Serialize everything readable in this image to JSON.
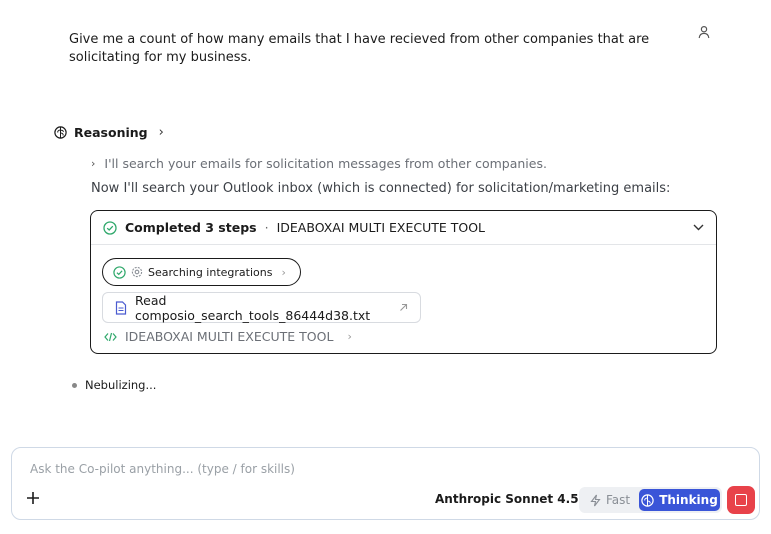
{
  "message": {
    "user_text": "Give me a count of how many emails that I have recieved from other companies  that are solicitating for my business."
  },
  "reasoning": {
    "label": "Reasoning",
    "step_text": "I'll search your emails for solicitation messages from other companies.",
    "followup_text": "Now I'll search your Outlook inbox (which is connected) for solicitation/marketing emails:"
  },
  "steps_card": {
    "completed_label": "Completed 3 steps",
    "separator": "·",
    "tool_name": "IDEABOXAI MULTI EXECUTE TOOL",
    "pill_label": "Searching integrations",
    "file_label": "Read composio_search_tools_86444d38.txt",
    "exec_label": "IDEABOXAI MULTI EXECUTE TOOL"
  },
  "status": {
    "text": "Nebulizing..."
  },
  "composer": {
    "placeholder": "Ask the Co-pilot anything... (type / for skills)",
    "model_label": "Anthropic Sonnet 4.5",
    "mode_fast": "Fast",
    "mode_thinking": "Thinking"
  },
  "colors": {
    "accent": "#3a55d8",
    "stop": "#e8424a",
    "success": "#2fa86b"
  }
}
